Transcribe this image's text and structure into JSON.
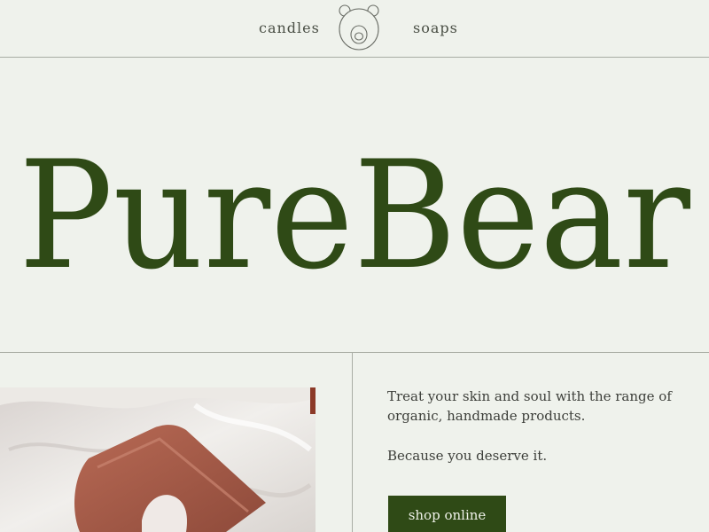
{
  "nav": {
    "left_link": "candles",
    "right_link": "soaps",
    "logo_icon": "bear-face-icon"
  },
  "hero": {
    "title": "PureBear"
  },
  "content": {
    "tagline": "Treat your skin and soul with the range of organic, handmade products.",
    "tagline_secondary": "Because you deserve it.",
    "cta_label": "shop online"
  },
  "colors": {
    "background": "#eff2ec",
    "brand_green": "#2f4a16",
    "divider": "#a9ada4",
    "body_text": "#3d3f3a"
  }
}
